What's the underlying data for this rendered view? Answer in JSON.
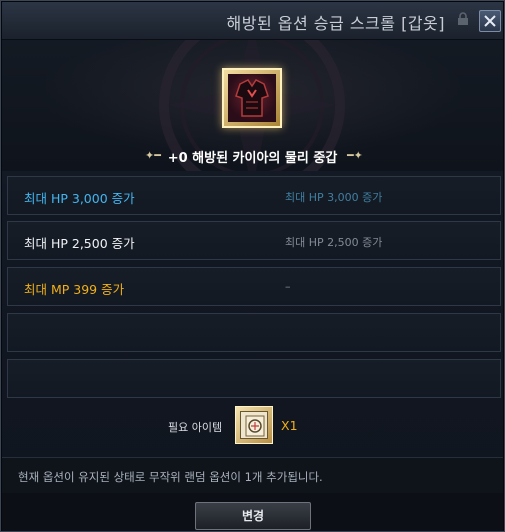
{
  "window": {
    "title": "해방된 옵션 승급 스크롤 [갑옷]",
    "lock_icon": "lock-icon",
    "close_icon": "close-icon"
  },
  "item": {
    "name": "+0 해방된 카이아의 물리 중갑",
    "icon": "armor-chestplate-icon"
  },
  "options": [
    {
      "current": "최대 HP 3,000 증가",
      "next": "최대 HP 3,000 증가",
      "color": "#43b6f0"
    },
    {
      "current": "최대 HP 2,500 증가",
      "next": "최대 HP 2,500 증가",
      "color": "#f0f2f5"
    },
    {
      "current": "최대 MP 399 증가",
      "next": "–",
      "color": "#f2b018"
    },
    {
      "current": "",
      "next": ""
    },
    {
      "current": "",
      "next": ""
    }
  ],
  "required": {
    "label": "필요 아이템",
    "icon": "scroll-icon",
    "count": "X1"
  },
  "description": "현재 옵션이 유지된 상태로 무작위 랜덤 옵션이 1개 추가됩니다.",
  "buttons": {
    "change": "변경"
  }
}
